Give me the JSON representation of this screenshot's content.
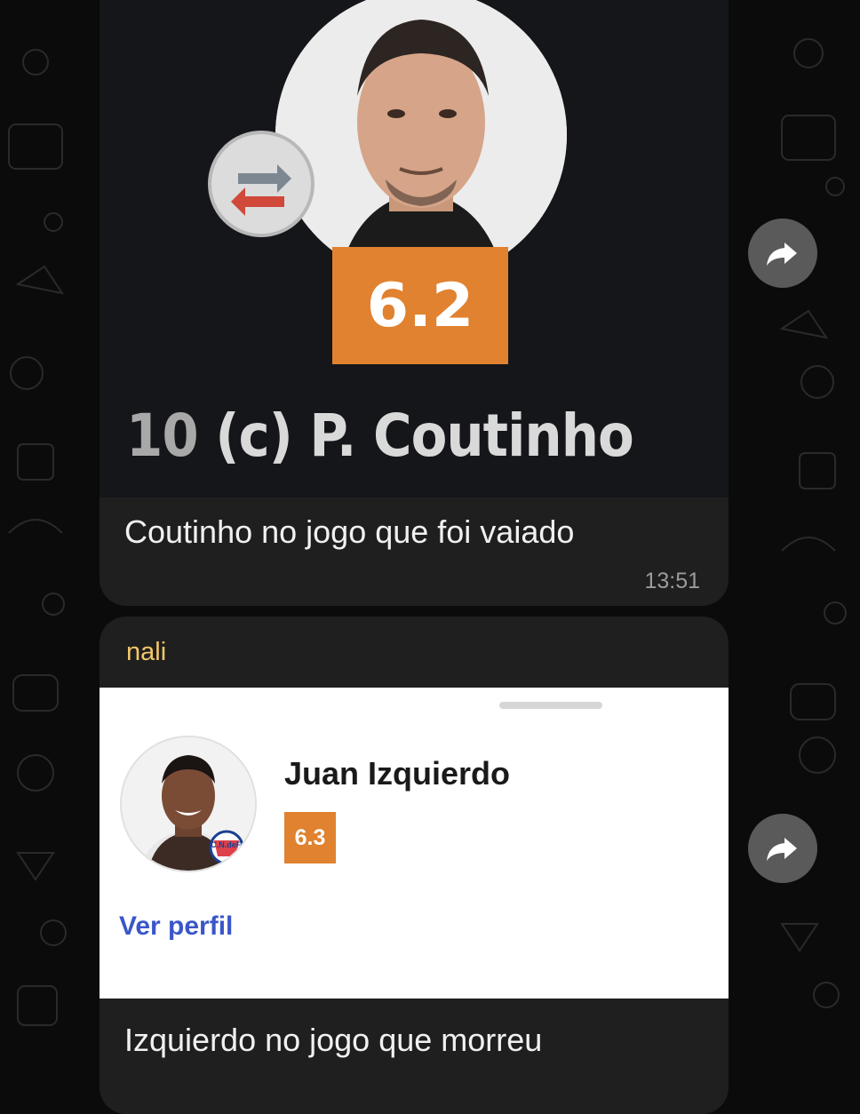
{
  "messages": [
    {
      "image": {
        "rating": "6.2",
        "player_number": "10",
        "player_name": "(c) P. Coutinho"
      },
      "caption": "Coutinho no jogo que foi vaiado",
      "time": "13:51"
    },
    {
      "sender": "nali",
      "card": {
        "name": "Juan Izquierdo",
        "rating": "6.3",
        "profile_link": "Ver perfil",
        "badge_text": "C.N.deF."
      },
      "caption": "Izquierdo no jogo que morreu"
    }
  ],
  "icons": {
    "forward": "forward-arrow-icon",
    "swap": "substitution-swap-icon"
  },
  "colors": {
    "background": "#0b0b0b",
    "bubble": "#1f1f1f",
    "rating_orange": "#e0822f",
    "sender_name": "#f2c66a",
    "link_blue": "#3a56c9"
  }
}
